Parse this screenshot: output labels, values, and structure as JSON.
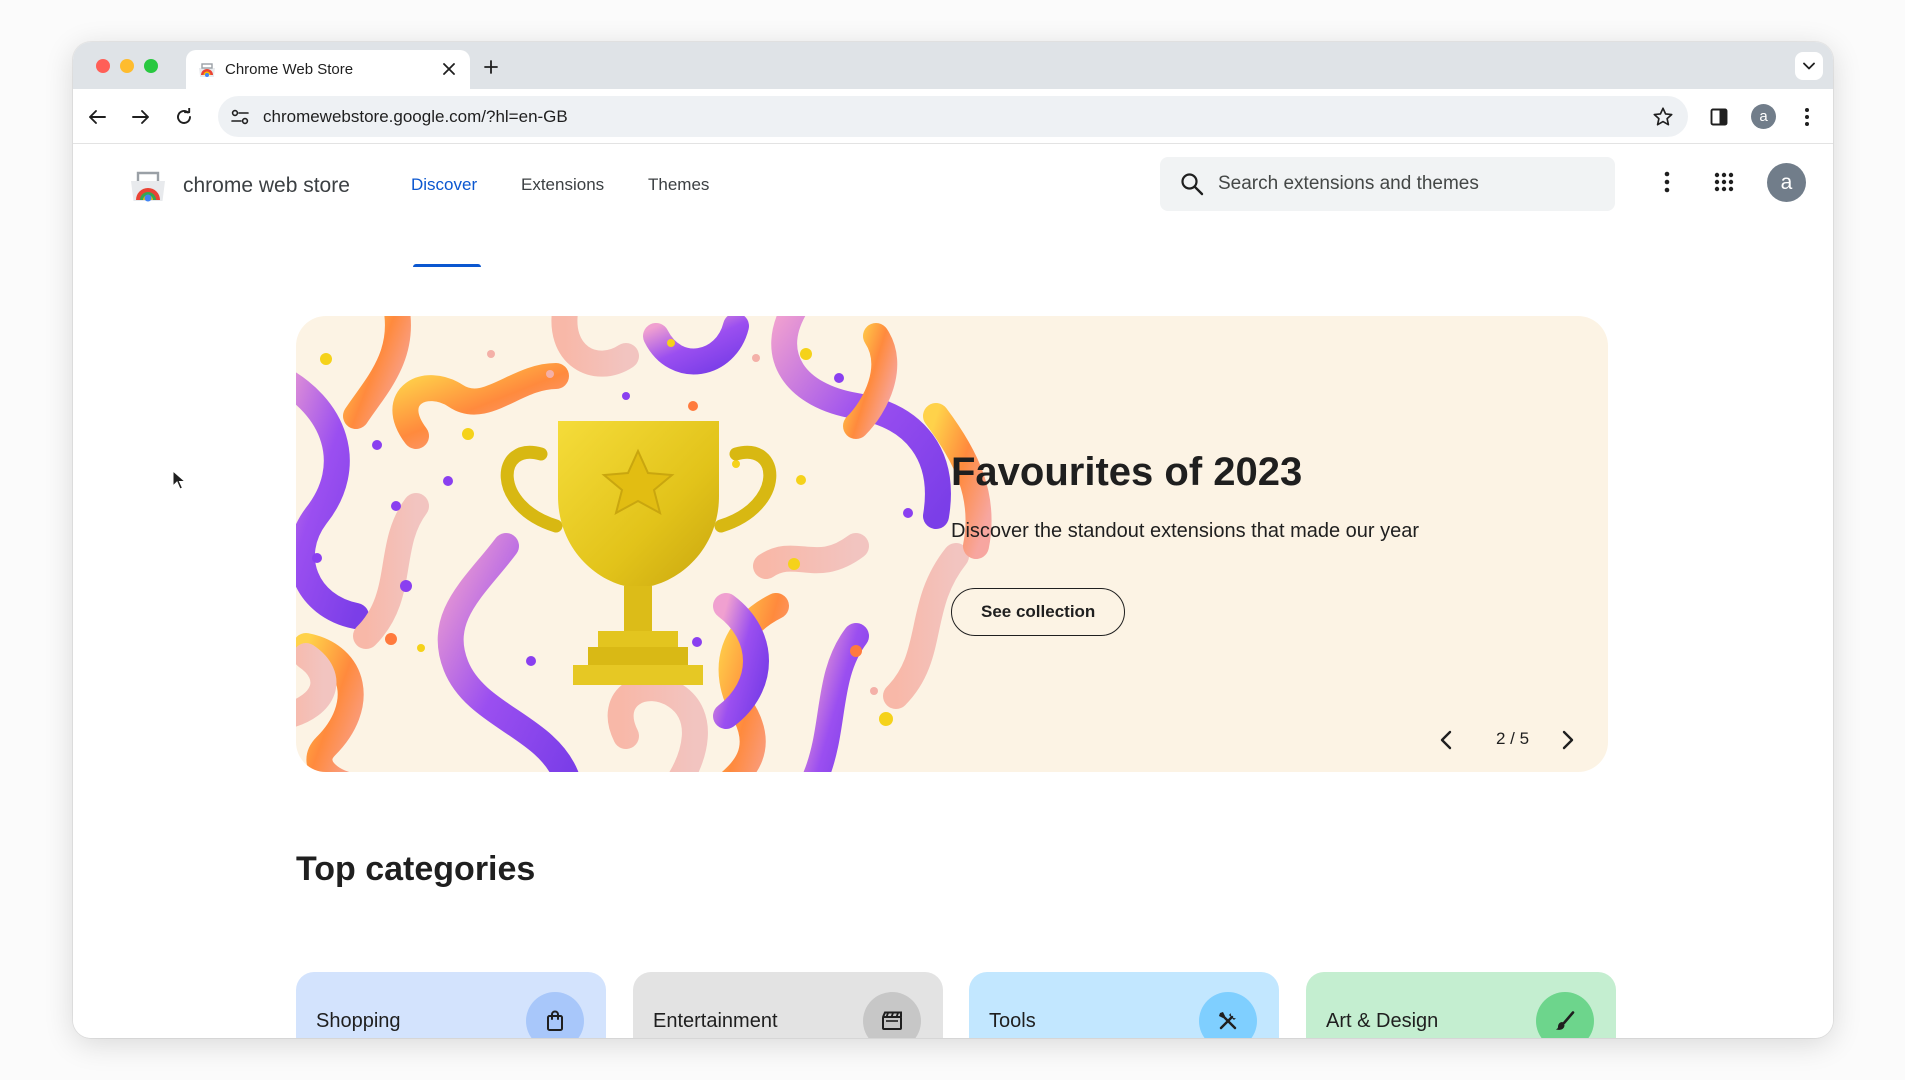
{
  "colors": {
    "accent": "#0b57d0",
    "hero_background": "#fcf3e4",
    "tab_strip": "#dfe3e7",
    "avatar": "#717d8a"
  },
  "browser": {
    "tab": {
      "title": "Chrome Web Store",
      "favicon": "chrome-web-store-icon"
    },
    "url": "chromewebstore.google.com/?hl=en-GB",
    "profile_initial": "a"
  },
  "header": {
    "logo_text": "chrome web store",
    "nav": [
      {
        "label": "Discover",
        "active": true
      },
      {
        "label": "Extensions",
        "active": false
      },
      {
        "label": "Themes",
        "active": false
      }
    ],
    "search": {
      "placeholder": "Search extensions and themes",
      "value": ""
    },
    "avatar_initial": "a"
  },
  "hero": {
    "title": "Favourites of 2023",
    "subtitle": "Discover the standout extensions that made our year",
    "cta_label": "See collection",
    "position": "2 / 5",
    "current_slide": 2,
    "total_slides": 5,
    "art": "trophy-illustration"
  },
  "categories": {
    "heading": "Top categories",
    "items": [
      {
        "label": "Shopping",
        "icon": "shopping-bag-icon"
      },
      {
        "label": "Entertainment",
        "icon": "clapperboard-icon"
      },
      {
        "label": "Tools",
        "icon": "tools-icon"
      },
      {
        "label": "Art & Design",
        "icon": "brush-icon"
      }
    ]
  }
}
